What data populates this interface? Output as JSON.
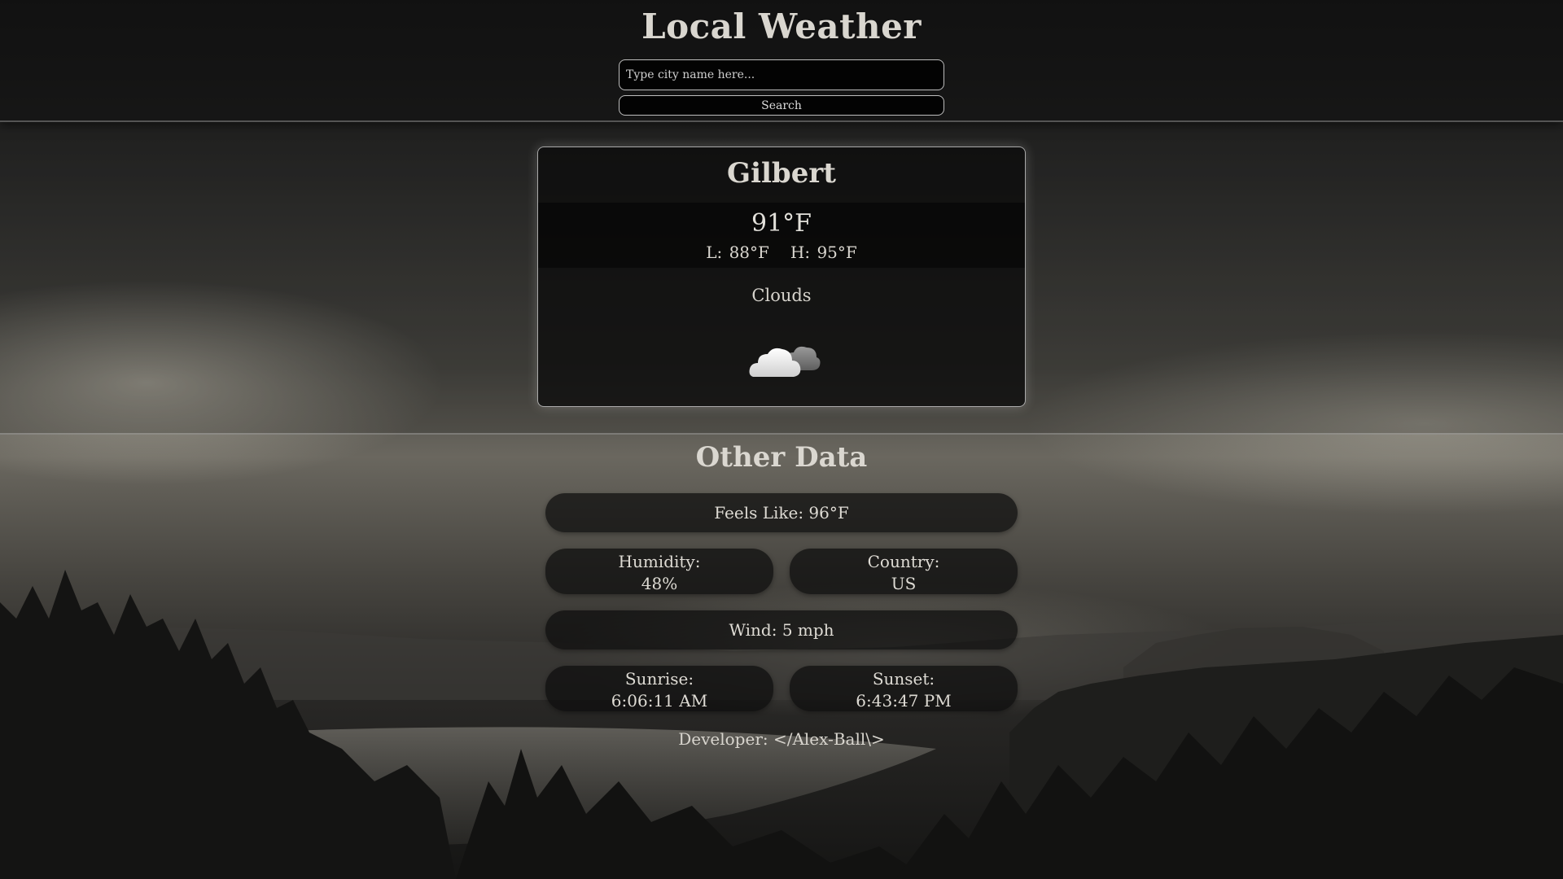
{
  "header": {
    "title": "Local Weather",
    "search_placeholder": "Type city name here...",
    "search_value": "",
    "search_button": "Search"
  },
  "weather": {
    "city": "Gilbert",
    "temperature": "91°F",
    "low": "L: 88°F",
    "high": "H: 95°F",
    "condition": "Clouds",
    "icon": "clouds-icon"
  },
  "other_data": {
    "title": "Other Data",
    "feels_like": "Feels Like: 96°F",
    "humidity_label": "Humidity:",
    "humidity_value": "48%",
    "country_label": "Country:",
    "country_value": "US",
    "wind": "Wind: 5 mph",
    "sunrise_label": "Sunrise:",
    "sunrise_value": "6:06:11 AM",
    "sunset_label": "Sunset:",
    "sunset_value": "6:43:47 PM"
  },
  "footer": {
    "developer": "Developer: </Alex-Ball\\>"
  },
  "colors": {
    "text": "#d9d6cf",
    "panel": "#0c0c0c",
    "border": "#bdbdbd"
  }
}
